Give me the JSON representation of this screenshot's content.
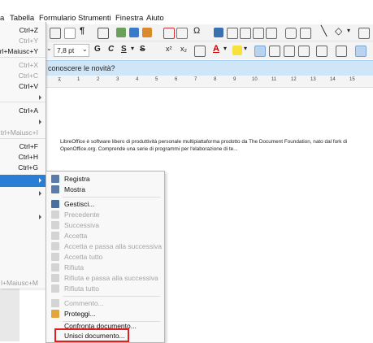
{
  "menubar": {
    "items": [
      "a",
      "Tabella",
      "Formulario",
      "Strumenti",
      "Finestra",
      "Aiuto"
    ]
  },
  "toolbar": {
    "font_size": "7,8 pt",
    "bold": "G",
    "italic": "C",
    "underline": "S",
    "strike": "S",
    "superscript": "x²",
    "subscript": "x₂",
    "font_color": "A"
  },
  "infobar": {
    "text": "conoscere le novità?"
  },
  "ruler": {
    "ticks": [
      "1",
      "2",
      "3",
      "4",
      "5",
      "6",
      "7",
      "8",
      "9",
      "10",
      "11",
      "12",
      "13",
      "14",
      "15"
    ]
  },
  "document": {
    "text": "LibreOffice è software libero di produttività personale multipiattaforma prodotto da The Document Foundation, nato dal fork di OpenOffice.org. Comprende una serie di programmi per l'elaborazione di te..."
  },
  "main_menu": {
    "shortcuts": [
      {
        "label": "Ctrl+Z",
        "enabled": true
      },
      {
        "label": "Ctrl+Y",
        "enabled": false
      },
      {
        "label": "rl+Maiusc+Y",
        "enabled": true
      },
      {
        "label": "Ctrl+X",
        "enabled": false
      },
      {
        "label": "Ctrl+C",
        "enabled": false
      },
      {
        "label": "Ctrl+V",
        "enabled": true
      },
      {
        "label": "Ctrl+A",
        "enabled": true
      },
      {
        "label": "trl+Maiusc+I",
        "enabled": false
      },
      {
        "label": "Ctrl+F",
        "enabled": true
      },
      {
        "label": "Ctrl+H",
        "enabled": true
      },
      {
        "label": "Ctrl+G",
        "enabled": true
      },
      {
        "label": "l+Maiusc+M",
        "enabled": false
      }
    ]
  },
  "track_changes_submenu": {
    "items": [
      {
        "label": "Registra",
        "enabled": true,
        "icon": "record-changes-icon"
      },
      {
        "label": "Mostra",
        "enabled": true,
        "icon": "show-changes-icon"
      },
      {
        "label": "Gestisci...",
        "enabled": true,
        "icon": "manage-changes-icon"
      },
      {
        "label": "Precedente",
        "enabled": false,
        "icon": "previous-change-icon"
      },
      {
        "label": "Successiva",
        "enabled": false,
        "icon": "next-change-icon"
      },
      {
        "label": "Accetta",
        "enabled": false,
        "icon": "accept-change-icon"
      },
      {
        "label": "Accetta e passa alla successiva",
        "enabled": false,
        "icon": "accept-next-icon"
      },
      {
        "label": "Accetta tutto",
        "enabled": false,
        "icon": "accept-all-icon"
      },
      {
        "label": "Rifiuta",
        "enabled": false,
        "icon": "reject-change-icon"
      },
      {
        "label": "Rifiuta e passa alla successiva",
        "enabled": false,
        "icon": "reject-next-icon"
      },
      {
        "label": "Rifiuta tutto",
        "enabled": false,
        "icon": "reject-all-icon"
      },
      {
        "label": "Commento...",
        "enabled": false,
        "icon": "comment-icon"
      },
      {
        "label": "Proteggi...",
        "enabled": true,
        "icon": "protect-icon"
      },
      {
        "label": "Confronta documento...",
        "enabled": true,
        "icon": ""
      },
      {
        "label": "Unisci documento...",
        "enabled": true,
        "icon": ""
      }
    ]
  },
  "colors": {
    "highlight": "#2a7ed6",
    "infobar": "#cfe6f8",
    "merge_outline": "#e02020"
  }
}
